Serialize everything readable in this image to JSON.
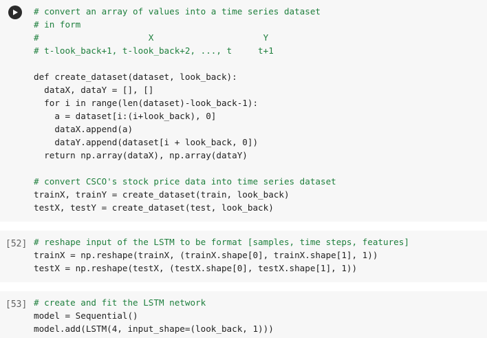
{
  "cells": [
    {
      "exec_label": "",
      "run_icon": "play-icon",
      "lines": [
        "# convert an array of values into a time series dataset",
        "# in form",
        "#                     X                     Y",
        "# t-look_back+1, t-look_back+2, ..., t     t+1",
        "",
        "def create_dataset(dataset, look_back):",
        "  dataX, dataY = [], []",
        "  for i in range(len(dataset)-look_back-1):",
        "    a = dataset[i:(i+look_back), 0]",
        "    dataX.append(a)",
        "    dataY.append(dataset[i + look_back, 0])",
        "  return np.array(dataX), np.array(dataY)",
        "",
        "# convert CSCO's stock price data into time series dataset",
        "trainX, trainY = create_dataset(train, look_back)",
        "testX, testY = create_dataset(test, look_back)"
      ]
    },
    {
      "exec_label": "[52]",
      "lines": [
        "# reshape input of the LSTM to be format [samples, time steps, features]",
        "trainX = np.reshape(trainX, (trainX.shape[0], trainX.shape[1], 1))",
        "testX = np.reshape(testX, (testX.shape[0], testX.shape[1], 1))"
      ]
    },
    {
      "exec_label": "[53]",
      "lines": [
        "# create and fit the LSTM network",
        "model = Sequential()",
        "model.add(LSTM(4, input_shape=(look_back, 1)))"
      ]
    }
  ]
}
